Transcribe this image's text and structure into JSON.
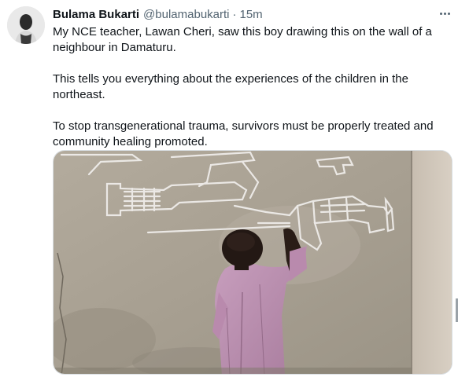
{
  "tweet": {
    "author_name": "Bulama Bukarti",
    "author_handle": "@bulamabukarti",
    "separator": "·",
    "time": "15m",
    "paragraphs": [
      "My NCE teacher, Lawan Cheri, saw this boy drawing this on the wall of a neighbour in Damaturu.",
      "This tells you everything about the experiences of the children in the northeast.",
      "To stop transgenerational trauma, survivors must be properly treated and community healing promoted."
    ]
  },
  "icons": {
    "more": "more-options-icon",
    "avatar": "avatar"
  }
}
